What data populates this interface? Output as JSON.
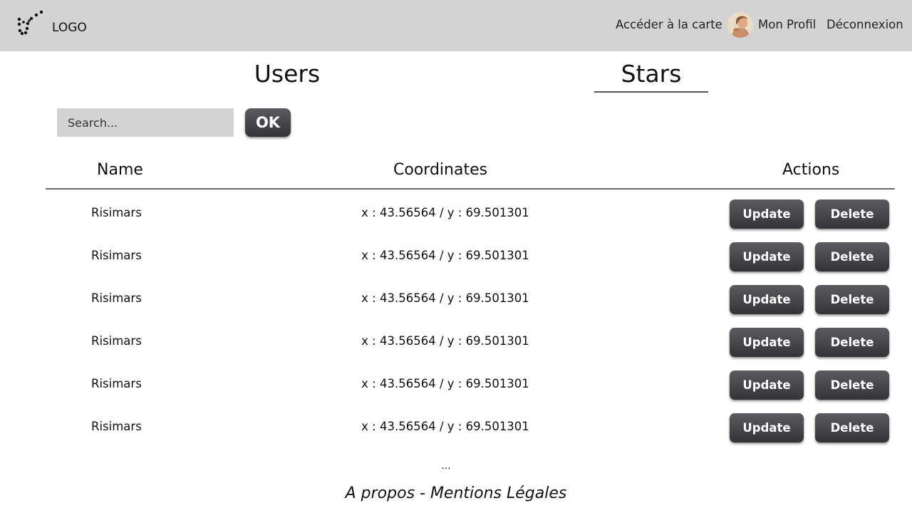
{
  "header": {
    "logo_text": "LOGO",
    "nav": {
      "map_link": "Accéder à la carte",
      "profile_link": "Mon Profil",
      "logout_link": "Déconnexion"
    }
  },
  "tabs": {
    "users": "Users",
    "stars": "Stars",
    "active": "stars"
  },
  "search": {
    "placeholder": "Search...",
    "value": "",
    "ok_label": "OK"
  },
  "table": {
    "headers": {
      "name": "Name",
      "coordinates": "Coordinates",
      "actions": "Actions"
    },
    "rows": [
      {
        "name": "Risimars",
        "coordinates": "x : 43.56564 / y : 69.501301"
      },
      {
        "name": "Risimars",
        "coordinates": "x : 43.56564 / y : 69.501301"
      },
      {
        "name": "Risimars",
        "coordinates": "x : 43.56564 / y : 69.501301"
      },
      {
        "name": "Risimars",
        "coordinates": "x : 43.56564 / y : 69.501301"
      },
      {
        "name": "Risimars",
        "coordinates": "x : 43.56564 / y : 69.501301"
      },
      {
        "name": "Risimars",
        "coordinates": "x : 43.56564 / y : 69.501301"
      }
    ],
    "update_label": "Update",
    "delete_label": "Delete",
    "more": "..."
  },
  "footer": {
    "text": "A propos - Mentions Légales"
  },
  "colors": {
    "header_bg": "#d3d3d3",
    "button_top": "#5b5b60",
    "button_bottom": "#333338",
    "input_bg": "#d3d3d3"
  }
}
